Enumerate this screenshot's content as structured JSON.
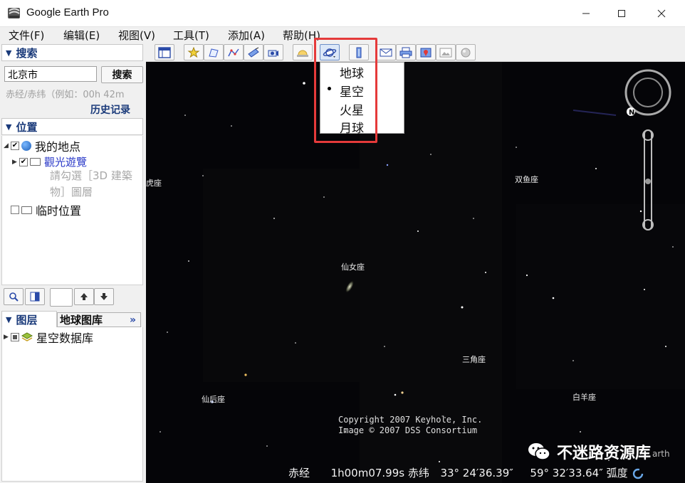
{
  "window": {
    "title": "Google Earth Pro"
  },
  "menu": [
    "文件(F)",
    "编辑(E)",
    "视图(V)",
    "工具(T)",
    "添加(A)",
    "帮助(H)"
  ],
  "search": {
    "header": "搜索",
    "input_value": "北京市",
    "button_label": "搜索",
    "hint": "赤经/赤纬（例如：00h 42m",
    "history_label": "历史记录"
  },
  "places": {
    "header": "位置",
    "items": [
      {
        "label": "我的地点"
      },
      {
        "label": "觀光遊覽"
      },
      {
        "label": "临时位置"
      }
    ],
    "sub_lines": [
      "請勾選［3D 建築",
      "物］圖層"
    ]
  },
  "layers": {
    "header": "图层",
    "gallery_label": "地球图库",
    "gallery_arrow": "»",
    "items": [
      {
        "label": "星空数据库"
      }
    ]
  },
  "dropdown": {
    "items": [
      "地球",
      "星空",
      "火星",
      "月球"
    ],
    "selected": "星空"
  },
  "sky": {
    "constellations": [
      {
        "label": "虎座"
      },
      {
        "label": "双鱼座"
      },
      {
        "label": "仙女座"
      },
      {
        "label": "三角座"
      },
      {
        "label": "仙后座"
      },
      {
        "label": "白羊座"
      }
    ],
    "copyright": [
      "Copyright 2007 Keyhole, Inc.",
      "Image © 2007 DSS Consortium"
    ]
  },
  "status": {
    "ra_label": "赤经",
    "ra_value": "1h00m07.99s",
    "dec_label": "赤纬",
    "dec_value": "33° 24′36.39″",
    "arc_value": "59° 32′33.64″",
    "arc_label": "弧度"
  },
  "watermark": {
    "text": "不迷路资源库",
    "suffix": "arth"
  },
  "colors": {
    "highlight": "#e53a3a",
    "header_text": "#1a3a7a",
    "link": "#2a39c8"
  }
}
